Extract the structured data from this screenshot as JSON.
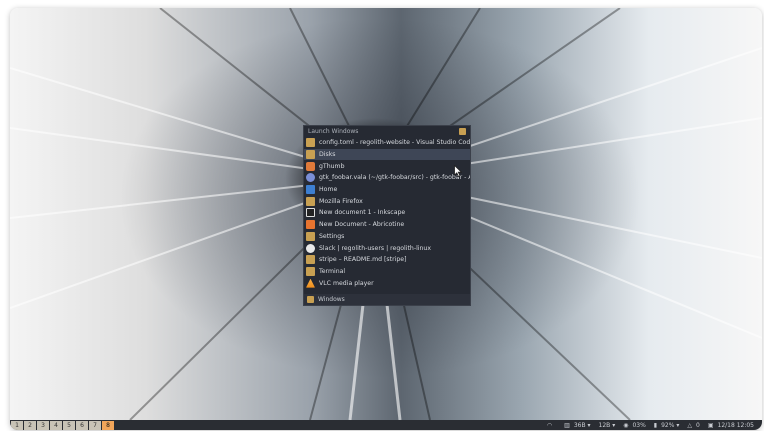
{
  "launcher": {
    "title": "Launch Windows",
    "items": [
      {
        "label": "config.toml - regolith-website - Visual Studio Code",
        "icon": "regolith-icon",
        "color": "#c8a052"
      },
      {
        "label": "Disks",
        "icon": "regolith-icon",
        "color": "#c8a052"
      },
      {
        "label": "gThumb",
        "icon": "gthumb-icon",
        "color": "#e07a3a"
      },
      {
        "label": "gtk_foobar.vala (~/gtk-foobar/src) - gtk-foobar - Anju",
        "icon": "anjuta-icon",
        "color": "#7b8fd6"
      },
      {
        "label": "Home",
        "icon": "folder-icon",
        "color": "#3d7fd1"
      },
      {
        "label": "Mozilla Firefox",
        "icon": "regolith-icon",
        "color": "#c8a052"
      },
      {
        "label": "New document 1 - Inkscape",
        "icon": "inkscape-icon",
        "color": "#222222"
      },
      {
        "label": "New Document - Abricotine",
        "icon": "abricotine-icon",
        "color": "#e8742f"
      },
      {
        "label": "Settings",
        "icon": "regolith-icon",
        "color": "#c8a052"
      },
      {
        "label": "Slack | regolith-users | regolith-linux",
        "icon": "slack-icon",
        "color": "#e9e9e9"
      },
      {
        "label": "stripe – README.md [stripe]",
        "icon": "regolith-icon",
        "color": "#c8a052"
      },
      {
        "label": "Terminal",
        "icon": "regolith-icon",
        "color": "#c8a052"
      },
      {
        "label": "VLC media player",
        "icon": "vlc-icon",
        "color": "#f08c1a"
      }
    ],
    "selected_index": 1,
    "footer_label": "Windows"
  },
  "taskbar": {
    "workspaces": [
      "1",
      "2",
      "3",
      "4",
      "5",
      "6",
      "7",
      "8"
    ],
    "active_workspace": "8",
    "status": [
      {
        "icon": "wifi-icon",
        "text": ""
      },
      {
        "icon": "memory-icon",
        "text": "36B"
      },
      {
        "icon": "disk-icon",
        "text": "12B"
      },
      {
        "icon": "cpu-icon",
        "text": "03%"
      },
      {
        "icon": "battery-icon",
        "text": "92%"
      },
      {
        "icon": "bell-icon",
        "text": "0"
      },
      {
        "icon": "calendar-icon",
        "text": "12/18 12:05"
      }
    ]
  }
}
